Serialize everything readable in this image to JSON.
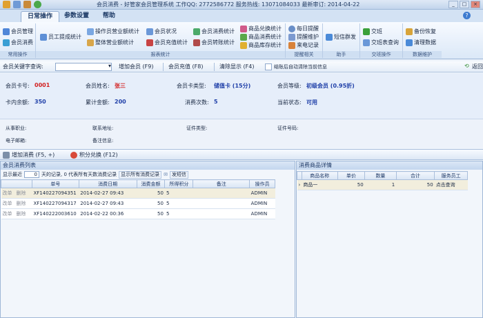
{
  "titlebar": {
    "title": "会员消费 - 好管家会员管理系统 工作QQ: 2772586772 服务热线: 13071084033 最新审订: 2014-04-22"
  },
  "tabs": [
    "日常操作",
    "参数设置",
    "帮助"
  ],
  "ribbon": {
    "groups": [
      "常用操作",
      "报表统计",
      "提醒相关",
      "助手",
      "交班操作",
      "数据维护"
    ],
    "common": [
      "会员管理",
      "会员消费"
    ],
    "staff": "员工提成统计",
    "reports": [
      "操作员营业额统计",
      "整体营业额统计",
      "会员状况",
      "会员充值统计",
      "会员消费统计",
      "会员转账统计"
    ],
    "goods": [
      "商品兑换统计",
      "商品消费统计",
      "商品库存统计"
    ],
    "remind": [
      "每日提醒",
      "提醒维护",
      "来电记录"
    ],
    "helper": "短信群发",
    "shift": [
      "交班",
      "交班表查询"
    ],
    "data": [
      "备份恢复",
      "清理数据"
    ]
  },
  "query": {
    "label": "会员关键字查询:",
    "value": "",
    "add_member": "增加会员 (F9)",
    "recharge": "会员充值 (F8)",
    "clear": "清除显示 (F4)",
    "auto_clear": "结账后自动清除当前信息",
    "back": "返回"
  },
  "member": {
    "card_no_label": "会员卡号:",
    "card_no": "0001",
    "name_label": "会员姓名:",
    "name": "张三",
    "card_type_label": "会员卡类型:",
    "card_type": "储值卡 (15分)",
    "level_label": "会员等级:",
    "level": "初级会员 (0.95折)",
    "balance_label": "卡内余额:",
    "balance": "350",
    "total_label": "累计金额:",
    "total": "200",
    "count_label": "消费次数:",
    "count": "5",
    "status_label": "当前状态:",
    "status": "可用"
  },
  "extra": {
    "job": "从事职业:",
    "address": "联系地址:",
    "cert_type": "证件类型:",
    "cert_no": "证件号码:",
    "email": "电子邮箱:",
    "note": "备注信息:"
  },
  "actions": {
    "add_consume": "增加消费 (F5, +)",
    "points": "积分兑换 (F12)"
  },
  "left_pane": {
    "title": "会员消费列表",
    "recent_prefix": "显示最近",
    "recent_days": "0",
    "recent_suffix": "天的记录, 0 代表所有天数消费记录",
    "show_all": "显示所有消费记录",
    "sms": "发短信",
    "columns": [
      "",
      "单号",
      "消费日期",
      "消费金额",
      "所得积分",
      "备注",
      "操作员"
    ],
    "rows": [
      {
        "act1": "改单",
        "act2": "删除",
        "no": "XF140227094351",
        "date": "2014-02-27 09:43",
        "amount": "50",
        "points": "5",
        "note": "",
        "op": "ADMIN"
      },
      {
        "act1": "改单",
        "act2": "删除",
        "no": "XF140227094317",
        "date": "2014-02-27 09:43",
        "amount": "50",
        "points": "5",
        "note": "",
        "op": "ADMIN"
      },
      {
        "act1": "改单",
        "act2": "删除",
        "no": "XF140222003610",
        "date": "2014-02-22 00:36",
        "amount": "50",
        "points": "5",
        "note": "",
        "op": "ADMIN"
      }
    ]
  },
  "right_pane": {
    "title": "消费商品详情",
    "columns": [
      "商品名称",
      "单价",
      "数量",
      "合计",
      "服务员工"
    ],
    "rows": [
      {
        "name": "商品一",
        "price": "50",
        "qty": "1",
        "sum": "50",
        "staff": "点击查询"
      }
    ]
  },
  "colors": {
    "accent": "#1d3a66",
    "red": "#d21f1f",
    "blue": "#1f3fa8",
    "selected_row": "#f2eedd"
  }
}
